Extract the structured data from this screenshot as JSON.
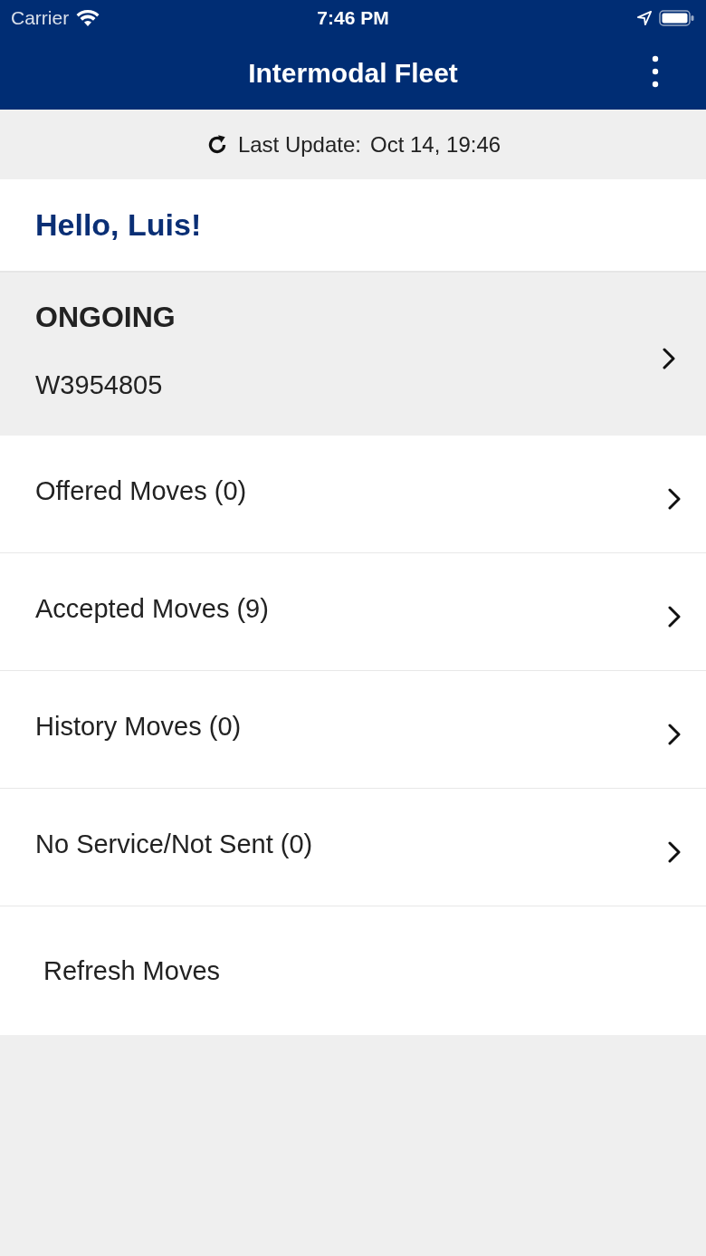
{
  "status_bar": {
    "carrier": "Carrier",
    "time": "7:46 PM"
  },
  "header": {
    "title": "Intermodal Fleet"
  },
  "update": {
    "label": "Last Update:",
    "value": "Oct 14, 19:46"
  },
  "greeting": "Hello, Luis!",
  "ongoing": {
    "heading": "ONGOING",
    "order": "W3954805"
  },
  "menu": [
    {
      "label": "Offered Moves (0)"
    },
    {
      "label": "Accepted Moves (9)"
    },
    {
      "label": "History Moves (0)"
    },
    {
      "label": "No Service/Not Sent (0)"
    }
  ],
  "refresh": "Refresh Moves"
}
